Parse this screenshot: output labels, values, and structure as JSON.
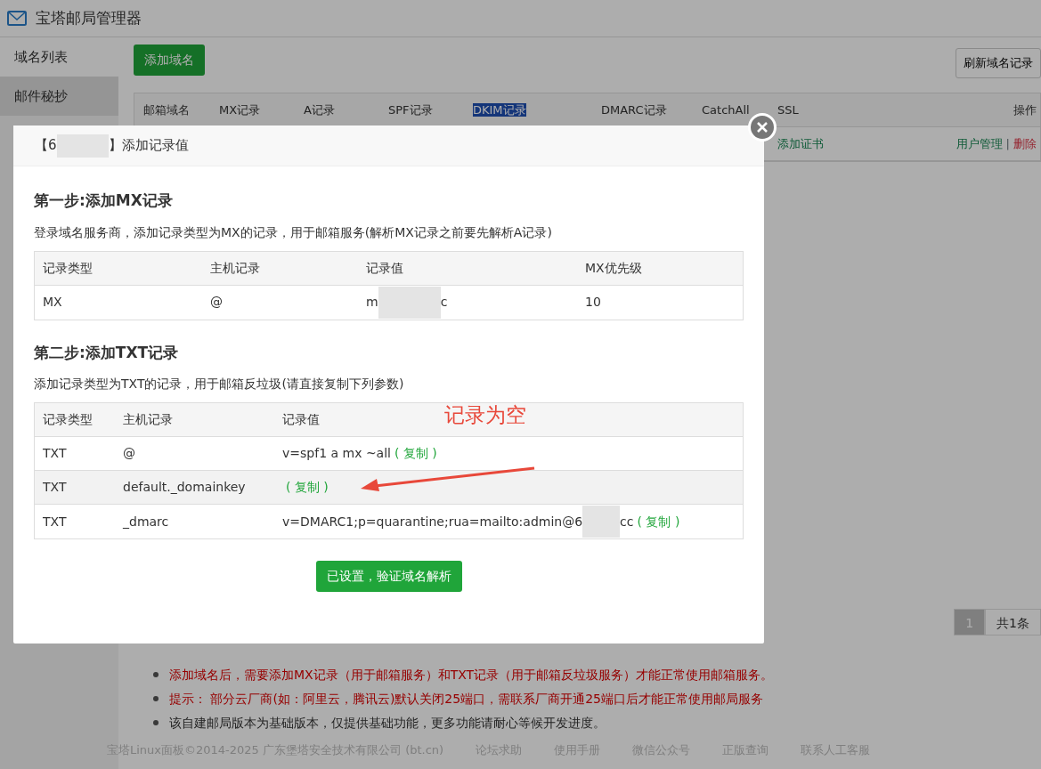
{
  "app": {
    "title": "宝塔邮局管理器"
  },
  "sidebar": {
    "items": [
      {
        "label": "域名列表",
        "selected": true
      },
      {
        "label": "邮件秘抄",
        "selected": false
      }
    ]
  },
  "toolbar": {
    "add_button": "添加域名",
    "refresh_button": "刷新域名记录"
  },
  "domain_table": {
    "columns": [
      {
        "label": "邮箱域名",
        "highlighted": false
      },
      {
        "label": "MX记录",
        "highlighted": false
      },
      {
        "label": "A记录",
        "highlighted": false
      },
      {
        "label": "SPF记录",
        "highlighted": false
      },
      {
        "label": "DKIM记录",
        "highlighted": true
      },
      {
        "label": "DMARC记录",
        "highlighted": false
      },
      {
        "label": "CatchAll",
        "highlighted": false
      },
      {
        "label": "SSL",
        "highlighted": false
      },
      {
        "label": "操作",
        "highlighted": false
      }
    ],
    "row": {
      "ssl_link": "添加证书",
      "separator": "|",
      "actions": [
        {
          "label": "用户管理",
          "kind": "link"
        },
        {
          "label": "删除",
          "kind": "danger"
        }
      ]
    }
  },
  "pagination": {
    "page": "1",
    "total": "共1条"
  },
  "notes": [
    {
      "text": "添加域名后，需要添加MX记录（用于邮箱服务）和TXT记录（用于邮箱反垃圾服务）才能正常使用邮箱服务。",
      "warning": true
    },
    {
      "text": "提示： 部分云厂商(如：阿里云，腾讯云)默认关闭25端口，需联系厂商开通25端口后才能正常使用邮局服务",
      "warning": true
    },
    {
      "text": "该自建邮局版本为基础版本，仅提供基础功能，更多功能请耐心等候开发进度。",
      "warning": false
    }
  ],
  "footer": {
    "copyright": "宝塔Linux面板©2014-2025 广东堡塔安全技术有限公司 (bt.cn)",
    "links": [
      "论坛求助",
      "使用手册",
      "微信公众号",
      "正版查询",
      "联系人工客服"
    ]
  },
  "dialog": {
    "title_start": "【6",
    "title_end": "】添加记录值",
    "steps": [
      {
        "heading": "第一步:添加MX记录",
        "description": "登录域名服务商，添加记录类型为MX的记录，用于邮箱服务(解析MX记录之前要先解析A记录)",
        "columns": [
          "记录类型",
          "主机记录",
          "记录值",
          "MX优先级"
        ],
        "rows": [
          {
            "cells": [
              "MX",
              "@"
            ],
            "value_start": "m",
            "value_end": "c",
            "redacted": true,
            "extra": "10",
            "highlighted": false
          }
        ]
      },
      {
        "heading": "第二步:添加TXT记录",
        "description": "添加记录类型为TXT的记录，用于邮箱反垃圾(请直接复制下列参数)",
        "columns": [
          "记录类型",
          "主机记录",
          "记录值"
        ],
        "rows": [
          {
            "cells": [
              "TXT",
              "@"
            ],
            "value_start": "v=spf1 a mx ~all",
            "redacted": false,
            "copy": "( 复制 )",
            "highlighted": false
          },
          {
            "cells": [
              "TXT",
              "default._domainkey"
            ],
            "redacted": false,
            "copy": "( 复制 )",
            "highlighted": true
          },
          {
            "cells": [
              "TXT",
              "_dmarc"
            ],
            "value_start": "v=DMARC1;p=quarantine;rua=mailto:admin@6",
            "value_end": "cc",
            "redacted": true,
            "copy": "( 复制 )",
            "highlighted": false
          }
        ]
      }
    ],
    "confirm_button": "已设置，验证域名解析"
  },
  "annotation": {
    "text": "记录为空"
  }
}
